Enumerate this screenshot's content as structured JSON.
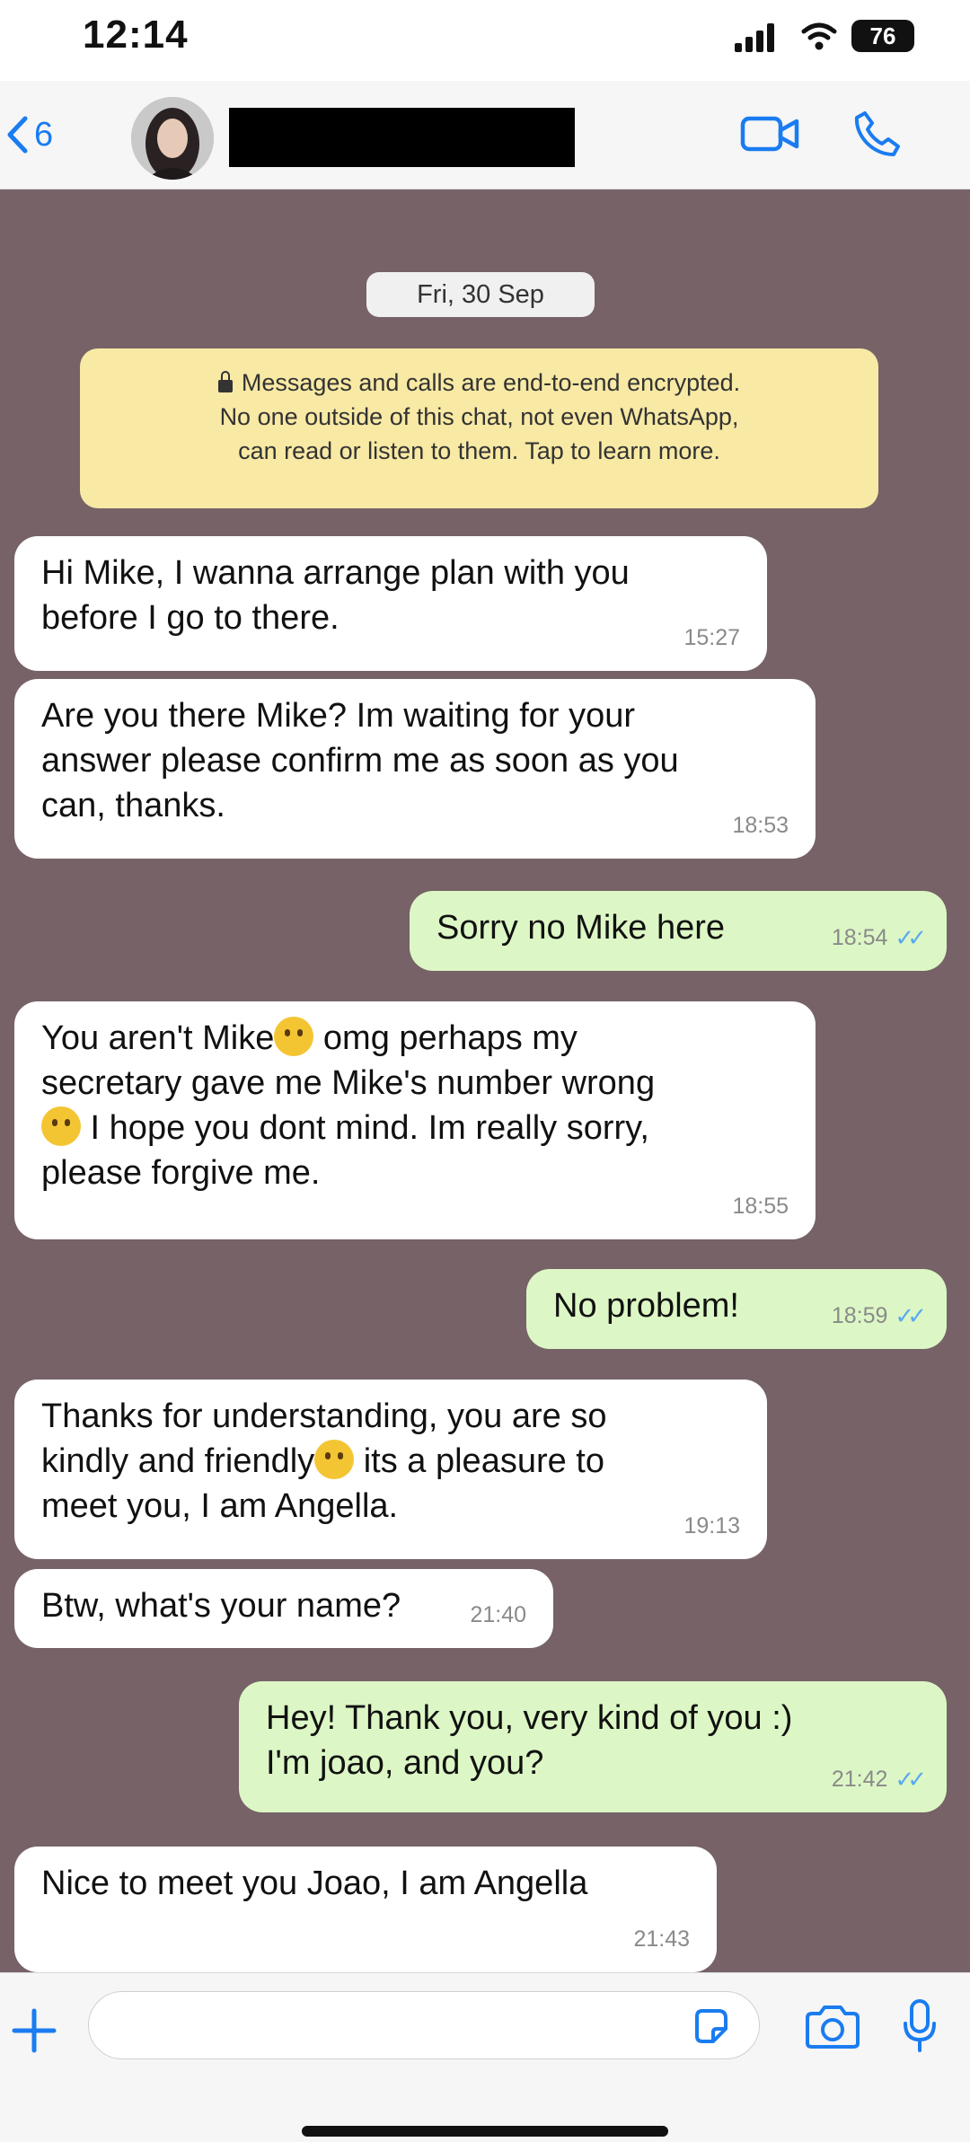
{
  "status_bar": {
    "time": "12:14",
    "battery": "76"
  },
  "header": {
    "back_count": "6"
  },
  "chat": {
    "date": "Fri, 30 Sep",
    "encryption_notice": [
      "Messages and calls are end-to-end encrypted.",
      "No one outside of this chat, not even WhatsApp,",
      "can read or listen to them. Tap to learn more."
    ],
    "messages": [
      {
        "direction": "in",
        "lines": [
          "Hi Mike, I wanna arrange plan with you",
          "before I go to there."
        ],
        "time": "15:27"
      },
      {
        "direction": "in",
        "lines": [
          "Are you there Mike? Im waiting for your",
          "answer please confirm me as soon as you",
          "can, thanks."
        ],
        "time": "18:53"
      },
      {
        "direction": "out",
        "text": "Sorry no Mike here",
        "time": "18:54"
      },
      {
        "direction": "in",
        "parts": [
          "You aren't Mike",
          " omg perhaps my",
          "secretary gave me Mike's number wrong",
          " I hope you dont mind. Im really sorry,",
          "please forgive me."
        ],
        "time": "18:55"
      },
      {
        "direction": "out",
        "text": "No problem!",
        "time": "18:59"
      },
      {
        "direction": "in",
        "parts": [
          "Thanks for understanding, you are so",
          "kindly and friendly",
          " its a pleasure to",
          "meet you, I am Angella."
        ],
        "time": "19:13"
      },
      {
        "direction": "in",
        "text": "Btw, what's your name?",
        "time": "21:40"
      },
      {
        "direction": "out",
        "lines": [
          "Hey! Thank you, very kind of you :)",
          "I'm joao, and you?"
        ],
        "time": "21:42"
      },
      {
        "direction": "in",
        "text": "Nice to meet you Joao, I am Angella",
        "time": "21:43"
      }
    ]
  },
  "input_bar": {
    "placeholder": ""
  },
  "colors": {
    "chat_bg": "#766267",
    "incoming": "#ffffff",
    "outgoing": "#dcf7c5",
    "notice": "#f8e9a4",
    "accent": "#1a7cf0"
  },
  "icons": [
    "chevron-left-icon",
    "video-camera-icon",
    "phone-icon",
    "plus-icon",
    "sticker-icon",
    "camera-icon",
    "microphone-icon",
    "lock-icon",
    "double-check-icon"
  ]
}
